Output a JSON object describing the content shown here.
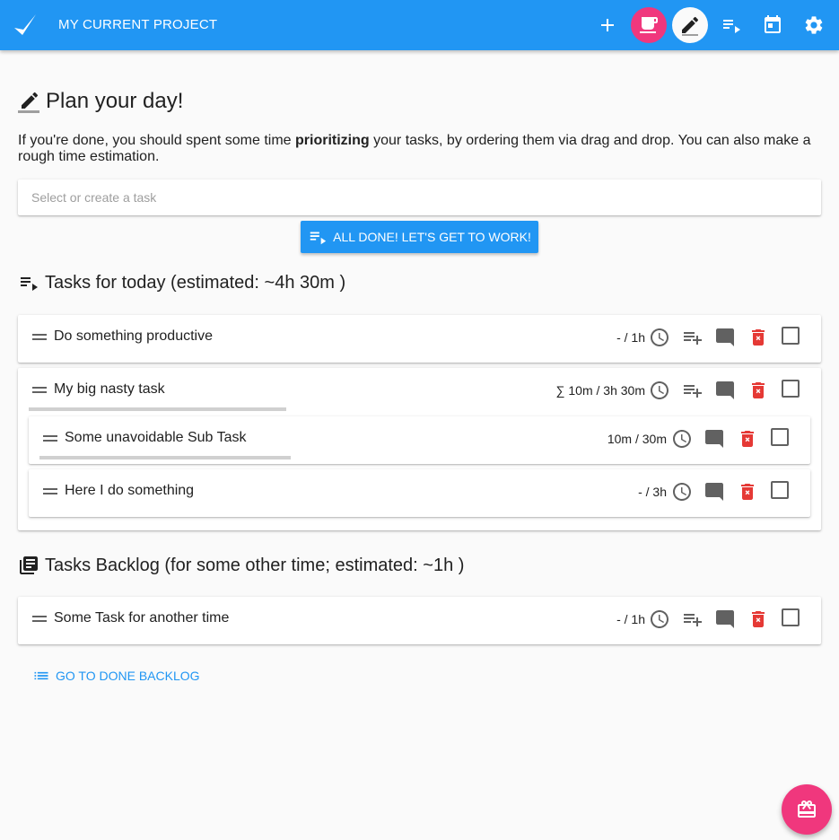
{
  "header": {
    "project_title": "MY CURRENT PROJECT",
    "icons": [
      "check-logo-icon",
      "add-icon",
      "coffee-icon",
      "pencil-icon",
      "playlist-play-icon",
      "calendar-icon",
      "settings-icon"
    ]
  },
  "plan": {
    "title": "Plan your day!",
    "intro_pre": "If you're done, you should spent some time ",
    "intro_bold": "prioritizing",
    "intro_post": " your tasks, by ordering them via drag and drop. You can also make a rough time estimation.",
    "select_placeholder": "Select or create a task",
    "done_button": "ALL DONE! LET'S GET TO WORK!"
  },
  "today": {
    "title": "Tasks for today (estimated: ~4h 30m )",
    "tasks": [
      {
        "name": "Do something productive",
        "time": "- / 1h"
      },
      {
        "name": "My big nasty task",
        "time": "∑ 10m / 3h 30m",
        "subtasks": [
          {
            "name": "Some unavoidable Sub Task",
            "time": "10m / 30m"
          },
          {
            "name": "Here I do something",
            "time": "- / 3h"
          }
        ]
      }
    ]
  },
  "backlog": {
    "title": "Tasks Backlog (for some other time; estimated: ~1h )",
    "tasks": [
      {
        "name": "Some Task for another time",
        "time": "- / 1h"
      }
    ]
  },
  "done_backlog_link": "GO TO DONE BACKLOG",
  "colors": {
    "primary": "#2196f3",
    "accent": "#f0377d",
    "delete": "#e53935"
  }
}
